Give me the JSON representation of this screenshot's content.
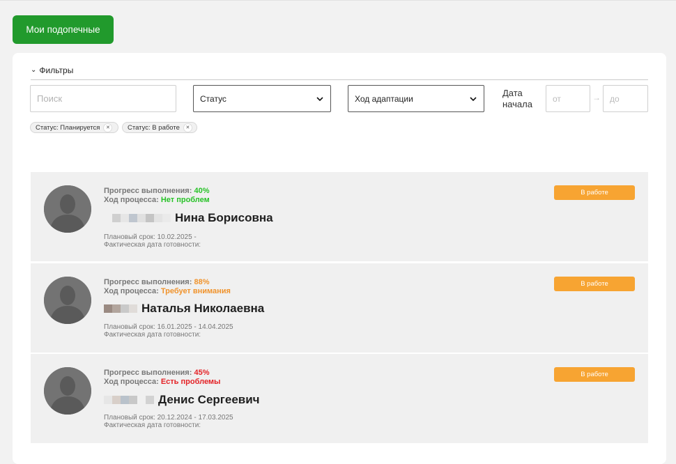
{
  "header": {
    "button_label": "Мои подопечные"
  },
  "filters": {
    "toggle_label": "Фильтры",
    "search_placeholder": "Поиск",
    "status_select": "Статус",
    "adaptation_select": "Ход адаптации",
    "date_label_line1": "Дата",
    "date_label_line2": "начала",
    "date_from_placeholder": "от",
    "date_to_placeholder": "до",
    "chips": [
      {
        "label": "Статус: Планируется"
      },
      {
        "label": "Статус: В работе"
      }
    ]
  },
  "colors": {
    "primary": "#219a2c",
    "status": "#f7a432",
    "ok": "#27c227",
    "warn": "#f0932c",
    "bad": "#e42226"
  },
  "cards": [
    {
      "progress_label": "Прогресс выполнения: ",
      "progress_value": "40%",
      "process_label": "Ход процесса: ",
      "process_value": "Нет проблем",
      "name": "Нина Борисовна",
      "plan_label": "Плановый срок: 10.02.2025 -",
      "fact_label": "Фактическая дата готовности:",
      "status": "В работе"
    },
    {
      "progress_label": "Прогресс выполнения: ",
      "progress_value": "88%",
      "process_label": "Ход процесса: ",
      "process_value": "Требует внимания",
      "name": "Наталья Николаевна",
      "plan_label": "Плановый срок: 16.01.2025 - 14.04.2025",
      "fact_label": "Фактическая дата готовности:",
      "status": "В работе"
    },
    {
      "progress_label": "Прогресс выполнения: ",
      "progress_value": "45%",
      "process_label": "Ход процесса: ",
      "process_value": "Есть проблемы",
      "name": "Денис Сергеевич",
      "plan_label": "Плановый срок: 20.12.2024 - 17.03.2025",
      "fact_label": "Фактическая дата готовности:",
      "status": "В работе"
    }
  ]
}
